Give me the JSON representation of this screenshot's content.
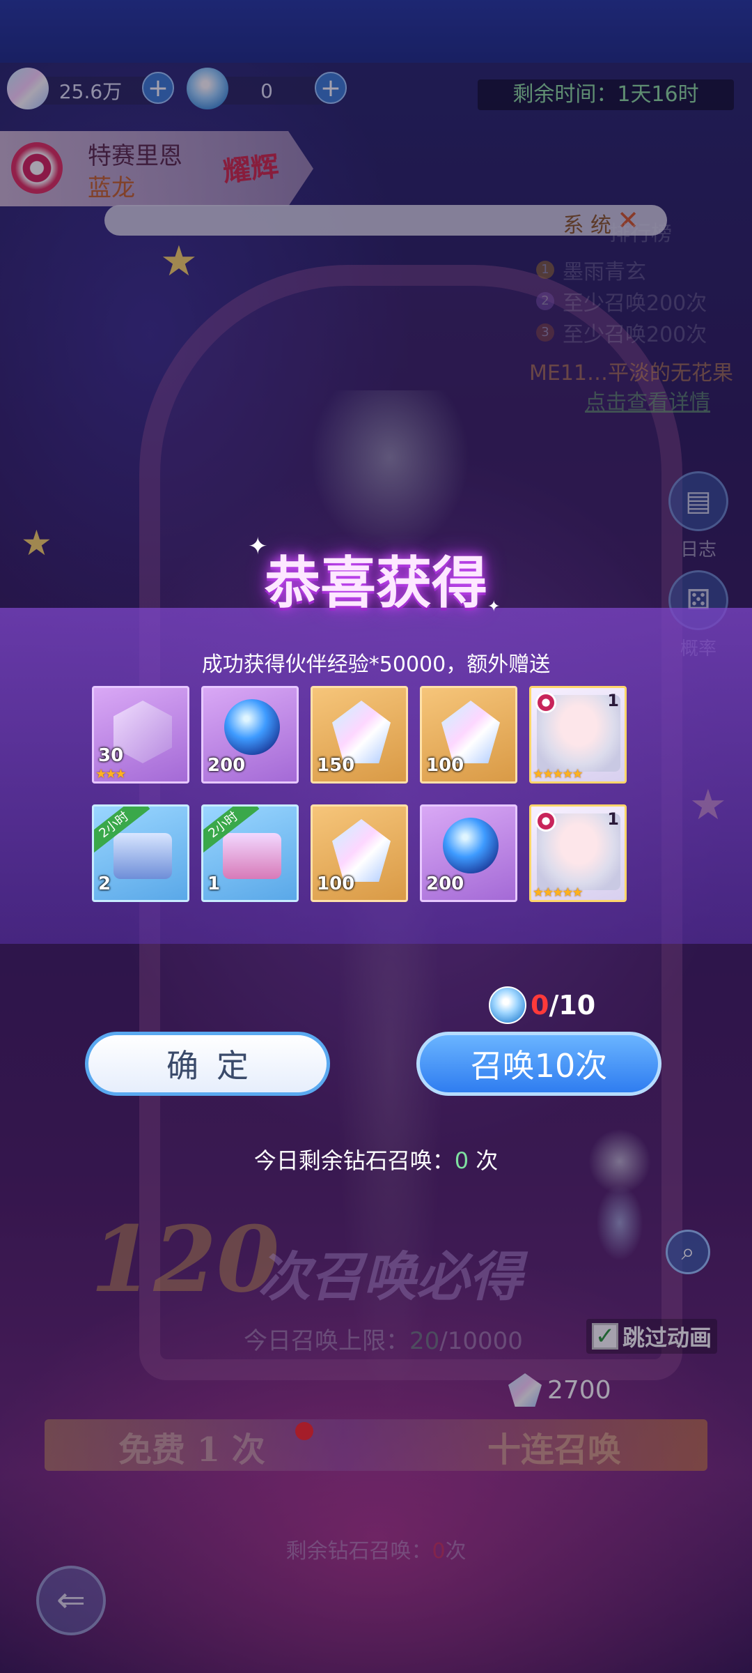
{
  "currency": [
    {
      "icon": "diamond-crystal-icon",
      "value": "25.6万"
    },
    {
      "icon": "summon-ticket-icon",
      "value": "0"
    }
  ],
  "timer": {
    "label": "剩余时间：",
    "value": "1天16时"
  },
  "featured_hero": {
    "name": "特赛里恩",
    "subtitle": "蓝龙",
    "badge": "耀辉"
  },
  "notice": {
    "text": "系  统"
  },
  "ranking": {
    "title": "排行榜",
    "entries": [
      {
        "rank": "1",
        "text": "墨雨青玄"
      },
      {
        "rank": "2",
        "text": "至少召唤200次"
      },
      {
        "rank": "3",
        "text": "至少召唤200次"
      }
    ],
    "extra": "ME11…平淡的无花果",
    "link": "点击查看详情"
  },
  "side_buttons": [
    {
      "icon": "log-icon",
      "label": "日志"
    },
    {
      "icon": "dice-icon",
      "label": "概率"
    }
  ],
  "modal": {
    "title": "恭喜获得",
    "subtitle": "成功获得伙伴经验*50000，额外赠送",
    "items": [
      {
        "type": "purple-cube",
        "count": "30",
        "stars": "★★★"
      },
      {
        "type": "blue-orb",
        "count": "200"
      },
      {
        "type": "diamond",
        "count": "150"
      },
      {
        "type": "diamond",
        "count": "100"
      },
      {
        "type": "hero-card",
        "corner": "1",
        "stars": "★★★★★"
      },
      {
        "type": "gold-chest",
        "count": "2",
        "tag": "2小时"
      },
      {
        "type": "pink-chest",
        "count": "1",
        "tag": "2小时"
      },
      {
        "type": "diamond",
        "count": "100"
      },
      {
        "type": "blue-orb",
        "count": "200"
      },
      {
        "type": "hero-card",
        "corner": "1",
        "stars": "★★★★★"
      }
    ],
    "ticket": {
      "current": "0",
      "total": "/10"
    },
    "confirm_label": "确定",
    "summon_label": "召唤10次",
    "diamond_today": {
      "prefix": "今日剩余钻石召唤：",
      "count": "0",
      "suffix": "次"
    }
  },
  "background": {
    "banner_number": "120",
    "banner_text": "次召唤必得",
    "daily_limit": {
      "prefix": "今日召唤上限：",
      "used": "20",
      "total": "/10000"
    },
    "skip_label": "跳过动画",
    "skip_checked": true,
    "cost": "2700",
    "free_label": "免费 1 次",
    "ten_label": "十连召唤",
    "remain_diamond": {
      "prefix": "剩余钻石召唤：",
      "count": "0",
      "suffix": "次"
    }
  },
  "colors": {
    "accent_blue": "#2f7df0",
    "title_glow": "#c14cf0",
    "highlight_green": "#7fe0a0",
    "alert_red": "#ff3a3a"
  }
}
